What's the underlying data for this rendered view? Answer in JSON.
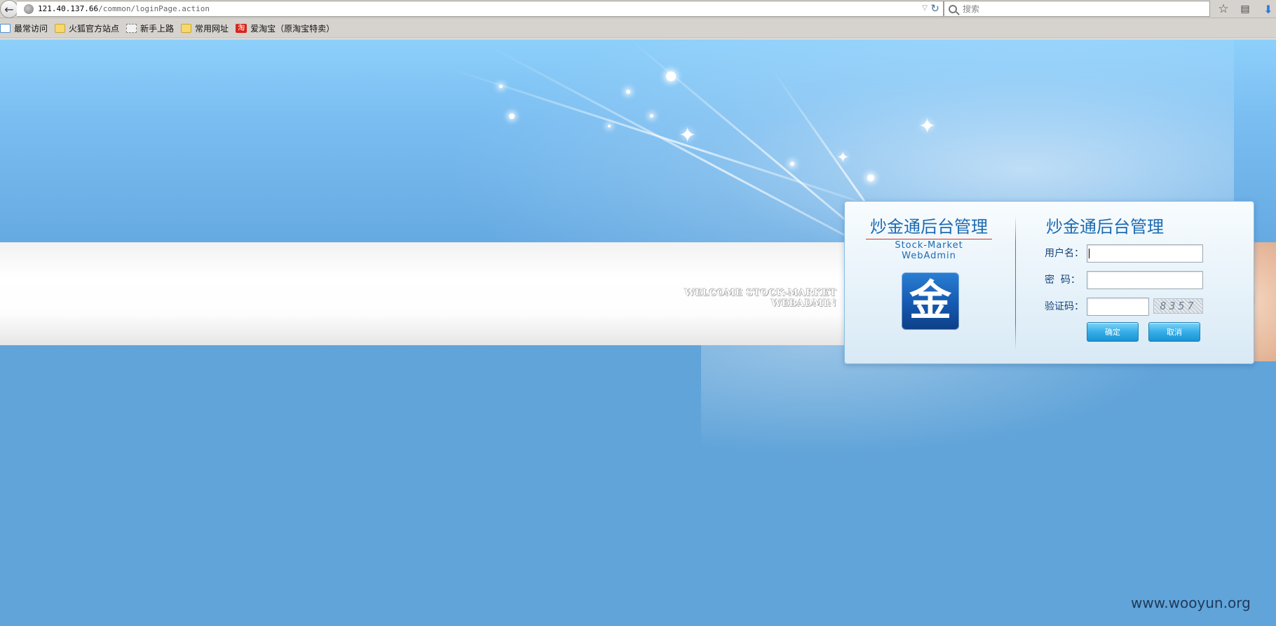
{
  "browser": {
    "url_host": "121.40.137.66",
    "url_path": "/common/loginPage.action",
    "search_placeholder": "搜索",
    "bookmarks": [
      {
        "label": "最常访问",
        "icon": "most-visited-icon"
      },
      {
        "label": "火狐官方站点",
        "icon": "folder-icon"
      },
      {
        "label": "新手上路",
        "icon": "page-icon"
      },
      {
        "label": "常用网址",
        "icon": "folder-icon"
      },
      {
        "label": "爱淘宝（原淘宝特卖）",
        "icon": "taobao-icon",
        "icon_text": "淘"
      }
    ]
  },
  "banner": {
    "welcome_text": "WELCOME STOCK-MARKET WEBADMIN"
  },
  "login": {
    "brand_title": "炒金通后台管理",
    "brand_subtitle": "Stock-Market WebAdmin",
    "logo_char": "金",
    "form_title": "炒金通后台管理",
    "username_label": "用户名：",
    "password_label": "密  码：",
    "captcha_label": "验证码：",
    "username_value": "",
    "password_value": "",
    "captcha_value": "",
    "captcha_image_text": "8357",
    "ok_label": "确定",
    "cancel_label": "取消"
  },
  "watermark": "www.wooyun.org",
  "colors": {
    "page_bg": "#61a4d9",
    "title_blue": "#1b6bb3",
    "button_blue": "#35aee8"
  }
}
